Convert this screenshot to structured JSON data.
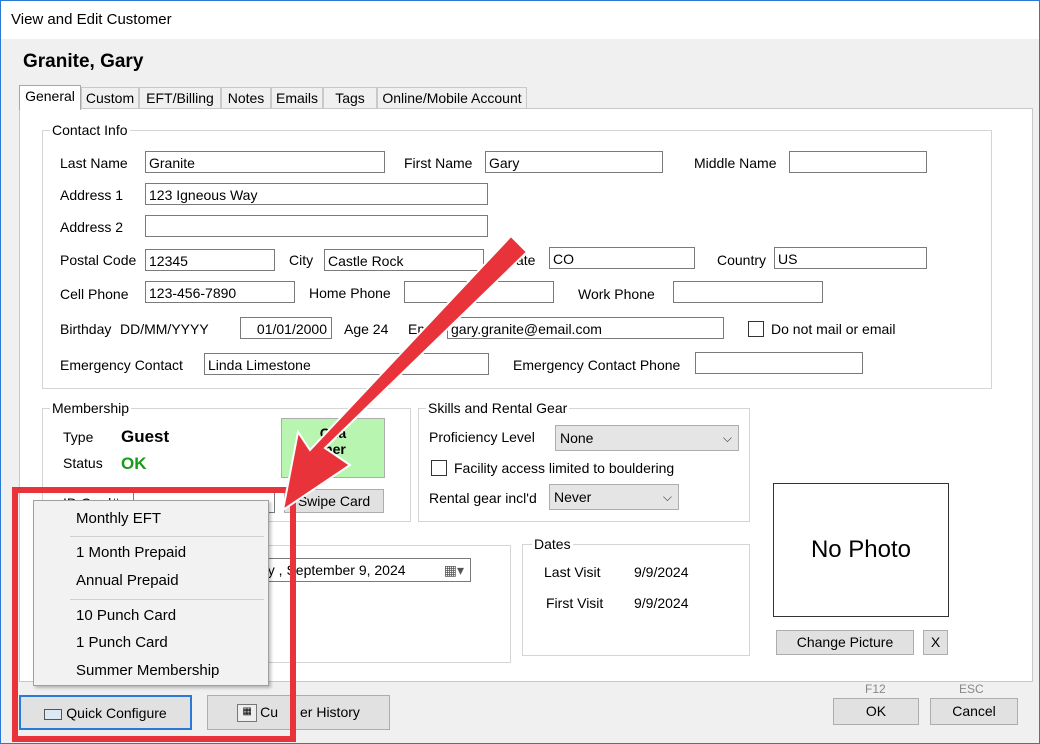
{
  "window": {
    "title": "View and Edit Customer"
  },
  "customer_heading": "Granite, Gary",
  "tabs": [
    "General",
    "Custom",
    "EFT/Billing",
    "Notes",
    "Emails",
    "Tags",
    "Online/Mobile Account"
  ],
  "contact": {
    "group_label": "Contact Info",
    "last_name_label": "Last Name",
    "last_name": "Granite",
    "first_name_label": "First Name",
    "first_name": "Gary",
    "middle_name_label": "Middle Name",
    "middle_name": "",
    "address1_label": "Address 1",
    "address1": "123 Igneous Way",
    "address2_label": "Address 2",
    "address2": "",
    "postal_label": "Postal Code",
    "postal": "12345",
    "city_label": "City",
    "city": "Castle Rock",
    "state_label_visible": "ate",
    "state": "CO",
    "country_label": "Country",
    "country": "US",
    "cell_label": "Cell Phone",
    "cell": "123-456-7890",
    "home_label": "Home Phone",
    "home": "",
    "work_label": "Work Phone",
    "work": "",
    "birthday_label": "Birthday",
    "birthday_format": "DD/MM/YYYY",
    "birthday": "01/01/2000",
    "age": "Age 24",
    "email_label_visible": "Em",
    "email": "gary.granite@email.com",
    "no_mail_label": "Do not mail or email",
    "emergency_label": "Emergency Contact",
    "emergency": "Linda Limestone",
    "emergency_phone_label": "Emergency Contact Phone",
    "emergency_phone": ""
  },
  "membership": {
    "group_label": "Membership",
    "type_label": "Type",
    "type": "Guest",
    "status_label": "Status",
    "status": "OK",
    "change_button_lines": [
      "Cha",
      "mer",
      "ype"
    ],
    "id_card_label": "ID Card#",
    "swipe_label": "Swipe Card",
    "date_value": "ay , September  9, 2024"
  },
  "skills": {
    "group_label": "Skills and Rental Gear",
    "proficiency_label": "Proficiency Level",
    "proficiency": "None",
    "facility_label": "Facility access limited to bouldering",
    "rental_label": "Rental gear incl'd",
    "rental": "Never"
  },
  "dates": {
    "group_label": "Dates",
    "last_visit_label": "Last Visit",
    "last_visit": "9/9/2024",
    "first_visit_label": "First Visit",
    "first_visit": "9/9/2024"
  },
  "photo": {
    "placeholder": "No Photo",
    "change_label": "Change Picture",
    "remove_label": "X"
  },
  "quick_menu": {
    "items": [
      "Monthly EFT",
      "1 Month Prepaid",
      "Annual Prepaid",
      "10 Punch Card",
      "1 Punch Card",
      "Summer Membership"
    ]
  },
  "footer": {
    "quick_configure": "Quick Configure",
    "customer_history_visible": "Cu",
    "customer_history_rest": "er History",
    "ok_hint": "F12",
    "ok": "OK",
    "cancel_hint": "ESC",
    "cancel": "Cancel"
  },
  "colors": {
    "highlight_red": "#e8333a",
    "status_green": "#1a9a1a",
    "change_button_bg": "#b8f5b0",
    "focus_blue": "#2b79d6"
  }
}
